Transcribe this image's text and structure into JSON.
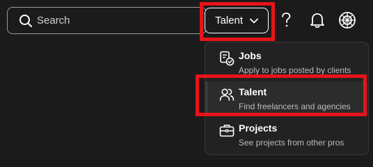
{
  "search": {
    "placeholder": "Search"
  },
  "header": {
    "talent_button_label": "Talent",
    "help_icon": "question-mark-icon",
    "notifications_icon": "bell-icon",
    "profile_icon": "profile-logo-icon"
  },
  "dropdown": {
    "items": [
      {
        "title": "Jobs",
        "description": "Apply to jobs posted by clients",
        "icon": "jobs-check-icon"
      },
      {
        "title": "Talent",
        "description": "Find freelancers and agencies",
        "icon": "people-icon"
      },
      {
        "title": "Projects",
        "description": "See projects from other pros",
        "icon": "briefcase-icon"
      }
    ]
  },
  "colors": {
    "background": "#1b1b1b",
    "highlight": "#e8131a",
    "text": "#ffffff",
    "muted_text": "#bdbdbd"
  }
}
